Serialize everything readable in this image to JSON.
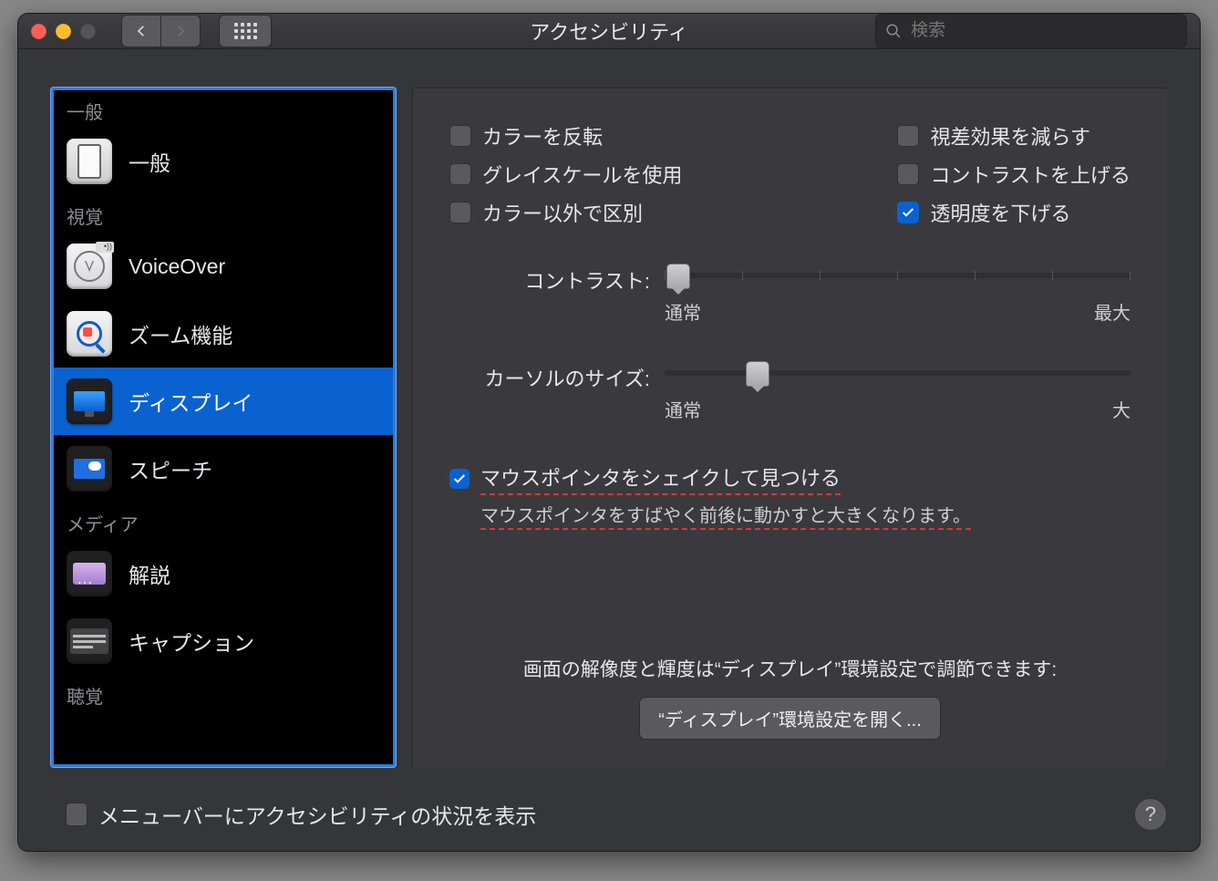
{
  "window_title": "アクセシビリティ",
  "search_placeholder": "検索",
  "sidebar": {
    "sections": {
      "general": "一般",
      "vision": "視覚",
      "media": "メディア",
      "hearing": "聴覚"
    },
    "items": {
      "general": "一般",
      "voiceover": "VoiceOver",
      "zoom": "ズーム機能",
      "display": "ディスプレイ",
      "speech": "スピーチ",
      "commentary": "解説",
      "caption": "キャプション"
    }
  },
  "checks": {
    "invert_colors": "カラーを反転",
    "grayscale": "グレイスケールを使用",
    "differentiate": "カラー以外で区別",
    "reduce_motion": "視差効果を減らす",
    "increase_contrast": "コントラストを上げる",
    "reduce_transparency": "透明度を下げる"
  },
  "sliders": {
    "contrast_label": "コントラスト:",
    "contrast_min": "通常",
    "contrast_max": "最大",
    "cursor_label": "カーソルのサイズ:",
    "cursor_min": "通常",
    "cursor_max": "大"
  },
  "shake": {
    "title": "マウスポインタをシェイクして見つける",
    "desc": "マウスポインタをすばやく前後に動かすと大きくなります。"
  },
  "footer_note": "画面の解像度と輝度は“ディスプレイ”環境設定で調節できます:",
  "open_display_prefs": "“ディスプレイ”環境設定を開く...",
  "menu_bar_status": "メニューバーにアクセシビリティの状況を表示"
}
